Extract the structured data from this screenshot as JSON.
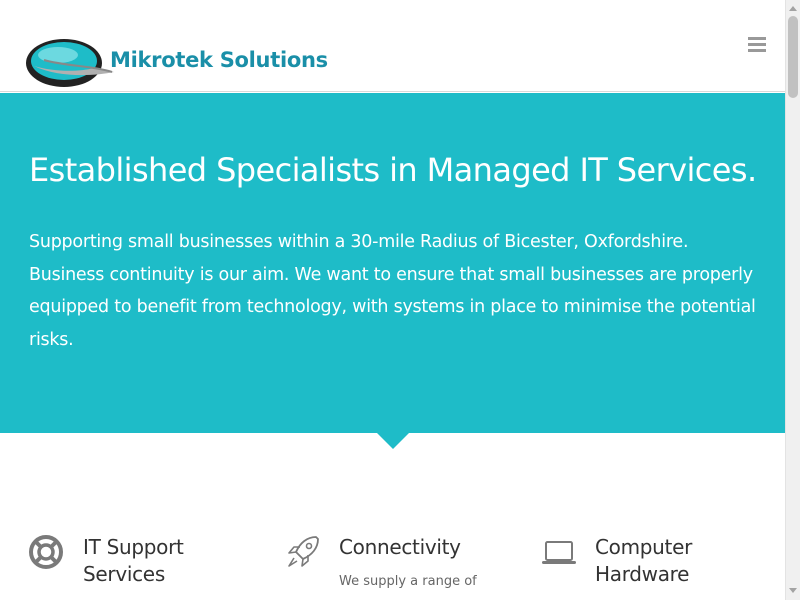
{
  "header": {
    "logo_text": "Mikrotek Solutions",
    "logo_icon": "globe-swoosh-logo",
    "menu_icon": "hamburger-menu-icon"
  },
  "hero": {
    "title": "Established Specialists in Managed IT Services.",
    "body": "Supporting small businesses within a 30-mile Radius of Bicester, Oxfordshire. Business continuity is our aim. We want to ensure that small businesses are properly equipped to benefit from technology, with systems in place to minimise the potential risks."
  },
  "features": [
    {
      "icon": "lifebuoy-icon",
      "title": "IT Support Services",
      "description": ""
    },
    {
      "icon": "rocket-icon",
      "title": "Connectivity",
      "description": "We supply a range of"
    },
    {
      "icon": "laptop-icon",
      "title": "Computer Hardware",
      "description": ""
    }
  ],
  "colors": {
    "accent": "#1ebcc8",
    "logo_text": "#1a8fa8",
    "icon_grey": "#7a7a7a"
  }
}
